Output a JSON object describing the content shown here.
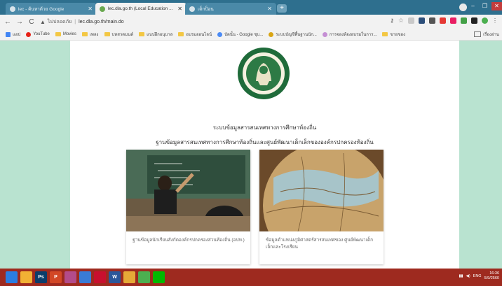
{
  "tabs": [
    {
      "label": "lec - ค้นหาด้วย Google"
    },
    {
      "label": "lec.dla.go.th (Local Education ..."
    },
    {
      "label": "เด็กป็อน"
    }
  ],
  "window": {
    "close": "✕",
    "new_tab": "+",
    "min": "–",
    "max": "❐",
    "x": "✕"
  },
  "toolbar": {
    "back": "←",
    "forward": "→",
    "reload": "C",
    "security_label": "ไม่ปลอดภัย",
    "url": "lec.dla.go.th/main.do"
  },
  "bookmarks": [
    {
      "label": "แอป",
      "type": "apps",
      "color": "#4285f4"
    },
    {
      "label": "YouTube",
      "type": "site",
      "color": "#e62117"
    },
    {
      "label": "Movies",
      "type": "folder"
    },
    {
      "label": "เพลง",
      "type": "folder"
    },
    {
      "label": "บทสวดมนต์",
      "type": "folder"
    },
    {
      "label": "แบบฝึกอนุบาล",
      "type": "folder"
    },
    {
      "label": "อบรมออนไลน์",
      "type": "folder"
    },
    {
      "label": "บัตนั้น - Google ชุบ...",
      "type": "site",
      "color": "#4b8bf5"
    },
    {
      "label": "ระบบบัญชีพื้นฐานนัก...",
      "type": "site",
      "color": "#d9a514"
    },
    {
      "label": "การจองห้องอบรมในการ...",
      "type": "site",
      "color": "#c58fd4"
    },
    {
      "label": "ขายของ",
      "type": "folder"
    }
  ],
  "bookmarks_other": "เรื่องอ่าน",
  "page": {
    "title": "ระบบข้อมูลสารสนเทศทางการศึกษาท้องถิ่น",
    "subtitle": "ฐานข้อมูลสารสนเทศทางการศึกษาท้องถิ่นและศูนย์พัฒนาเด็กเล็กขององค์กรปกครองท้องถิ่น",
    "cards": [
      {
        "caption": "ฐานข้อมูลนักเรียนสังกัดองค์กรปกครองส่วนท้องถิ่น (อปท.)"
      },
      {
        "caption": "ข้อมูลตำแหน่งภูมิศาสตร์สารสนเทศของ ศูนย์พัฒนาเด็กเล็กและโรงเรียน"
      }
    ]
  },
  "taskbar": {
    "apps": [
      {
        "name": "windows",
        "label": "",
        "color": "#2a7de1"
      },
      {
        "name": "file-explorer",
        "label": "",
        "color": "#f2b134"
      },
      {
        "name": "photoshop",
        "label": "Ps",
        "color": "#0b3d6b"
      },
      {
        "name": "powerpoint",
        "label": "P",
        "color": "#d24726"
      },
      {
        "name": "media",
        "label": "",
        "color": "#b34b8a"
      },
      {
        "name": "browser",
        "label": "",
        "color": "#3a7bd5"
      },
      {
        "name": "acrobat",
        "label": "",
        "color": "#c8102e"
      },
      {
        "name": "word",
        "label": "W",
        "color": "#2b579a"
      },
      {
        "name": "folder",
        "label": "",
        "color": "#e6a937"
      },
      {
        "name": "chrome",
        "label": "",
        "color": "#4caf50"
      },
      {
        "name": "line",
        "label": "",
        "color": "#00b900"
      }
    ],
    "lang": "ENG",
    "time": "16:36",
    "date": "5/9/2560"
  }
}
